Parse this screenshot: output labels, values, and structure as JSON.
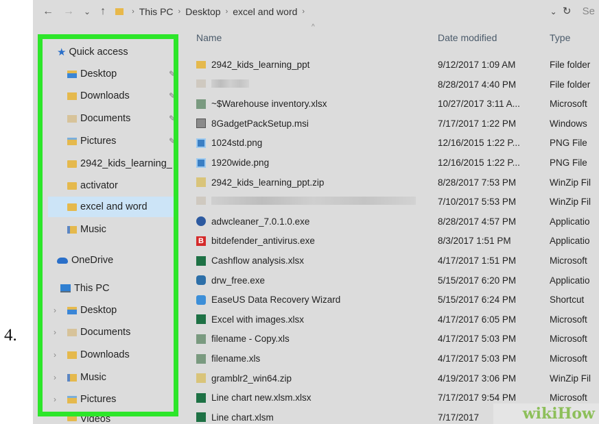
{
  "step_number": "4.",
  "address_bar": {
    "crumbs": [
      "This PC",
      "Desktop",
      "excel and word"
    ],
    "search_partial": "Se"
  },
  "columns": {
    "name": "Name",
    "date": "Date modified",
    "type": "Type"
  },
  "nav": {
    "quick_access": "Quick access",
    "desktop": "Desktop",
    "downloads": "Downloads",
    "documents": "Documents",
    "pictures": "Pictures",
    "kids": "2942_kids_learning_",
    "activator": "activator",
    "excel_word": "excel and word",
    "music": "Music",
    "onedrive": "OneDrive",
    "this_pc": "This PC",
    "pc_desktop": "Desktop",
    "pc_documents": "Documents",
    "pc_downloads": "Downloads",
    "pc_music": "Music",
    "pc_pictures": "Pictures",
    "pc_videos": "Videos"
  },
  "files": [
    {
      "name": "2942_kids_learning_ppt",
      "date": "9/12/2017 1:09 AM",
      "type": "File folder",
      "icon": "folder"
    },
    {
      "name": "",
      "date": "8/28/2017 4:40 PM",
      "type": "File folder",
      "icon": "blur"
    },
    {
      "name": "~$Warehouse inventory.xlsx",
      "date": "10/27/2017 3:11 A...",
      "type": "Microsoft",
      "icon": "xls"
    },
    {
      "name": "8GadgetPackSetup.msi",
      "date": "7/17/2017 1:22 PM",
      "type": "Windows",
      "icon": "msi"
    },
    {
      "name": "1024std.png",
      "date": "12/16/2015 1:22 P...",
      "type": "PNG File",
      "icon": "png"
    },
    {
      "name": "1920wide.png",
      "date": "12/16/2015 1:22 P...",
      "type": "PNG File",
      "icon": "png"
    },
    {
      "name": "2942_kids_learning_ppt.zip",
      "date": "8/28/2017 7:53 PM",
      "type": "WinZip Fil",
      "icon": "zip"
    },
    {
      "name": "",
      "date": "7/10/2017 5:53 PM",
      "type": "WinZip Fil",
      "icon": "blurbar"
    },
    {
      "name": "adwcleaner_7.0.1.0.exe",
      "date": "8/28/2017 4:57 PM",
      "type": "Applicatio",
      "icon": "shield"
    },
    {
      "name": "bitdefender_antivirus.exe",
      "date": "8/3/2017 1:51 PM",
      "type": "Applicatio",
      "icon": "bd"
    },
    {
      "name": "Cashflow analysis.xlsx",
      "date": "4/17/2017 1:51 PM",
      "type": "Microsoft",
      "icon": "xlsx"
    },
    {
      "name": "drw_free.exe",
      "date": "5/15/2017 6:20 PM",
      "type": "Applicatio",
      "icon": "exe"
    },
    {
      "name": "EaseUS Data Recovery Wizard",
      "date": "5/15/2017 6:24 PM",
      "type": "Shortcut",
      "icon": "ease"
    },
    {
      "name": "Excel with images.xlsx",
      "date": "4/17/2017 6:05 PM",
      "type": "Microsoft",
      "icon": "xlsx"
    },
    {
      "name": "filename - Copy.xls",
      "date": "4/17/2017 5:03 PM",
      "type": "Microsoft",
      "icon": "xls"
    },
    {
      "name": "filename.xls",
      "date": "4/17/2017 5:03 PM",
      "type": "Microsoft",
      "icon": "xls"
    },
    {
      "name": "gramblr2_win64.zip",
      "date": "4/19/2017 3:06 PM",
      "type": "WinZip Fil",
      "icon": "zip"
    },
    {
      "name": "Line chart new.xlsm.xlsx",
      "date": "7/17/2017 9:54 PM",
      "type": "Microsoft",
      "icon": "xlsx"
    },
    {
      "name": "Line chart.xlsm",
      "date": "7/17/2017",
      "type": "",
      "icon": "xlsx"
    }
  ],
  "watermark": "wikiHow",
  "colors": {
    "highlight_border": "#2de62a",
    "selected_bg": "#cce4f7"
  }
}
